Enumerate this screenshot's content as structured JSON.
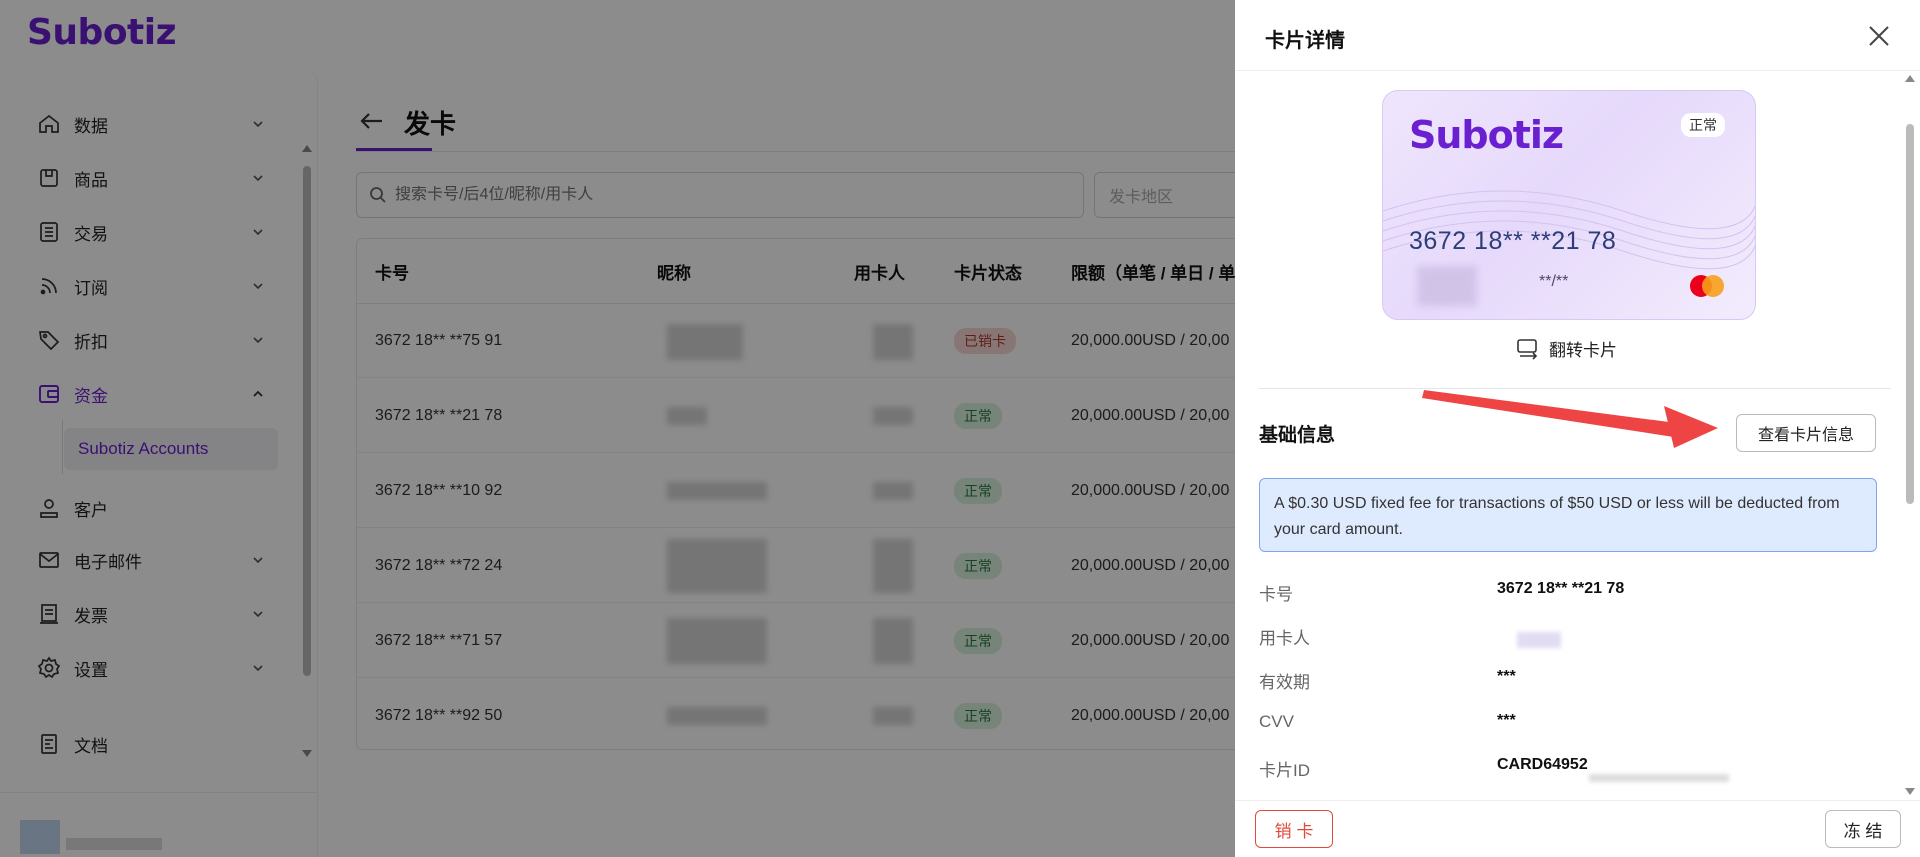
{
  "app": {
    "logo": "Subotiz"
  },
  "sidebar": {
    "items": [
      {
        "label": "数据",
        "icon": "home-icon",
        "expanded": false
      },
      {
        "label": "商品",
        "icon": "box-icon",
        "expanded": false
      },
      {
        "label": "交易",
        "icon": "list-icon",
        "expanded": false
      },
      {
        "label": "订阅",
        "icon": "rss-icon",
        "expanded": false
      },
      {
        "label": "折扣",
        "icon": "tag-icon",
        "expanded": false
      },
      {
        "label": "资金",
        "icon": "wallet-icon",
        "expanded": true
      },
      {
        "label": "客户",
        "icon": "user-icon",
        "expanded": false
      },
      {
        "label": "电子邮件",
        "icon": "mail-icon",
        "expanded": false
      },
      {
        "label": "发票",
        "icon": "invoice-icon",
        "expanded": false
      },
      {
        "label": "设置",
        "icon": "gear-icon",
        "expanded": false
      }
    ],
    "sub_item": "Subotiz Accounts",
    "docs": "文档",
    "active_color": "#6a1fd0"
  },
  "page": {
    "title": "发卡",
    "search_placeholder": "搜索卡号/后4位/昵称/用卡人",
    "region_placeholder": "发卡地区"
  },
  "table": {
    "headers": [
      "卡号",
      "昵称",
      "用卡人",
      "卡片状态",
      "限额（单笔 / 单日 / 单"
    ],
    "rows": [
      {
        "card": "3672 18** **75 91",
        "status": "已销卡",
        "status_type": "closed",
        "limit": "20,000.00USD / 20,00"
      },
      {
        "card": "3672 18** **21 78",
        "status": "正常",
        "status_type": "ok",
        "limit": "20,000.00USD / 20,00"
      },
      {
        "card": "3672 18** **10 92",
        "status": "正常",
        "status_type": "ok",
        "limit": "20,000.00USD / 20,00"
      },
      {
        "card": "3672 18** **72 24",
        "status": "正常",
        "status_type": "ok",
        "limit": "20,000.00USD / 20,00"
      },
      {
        "card": "3672 18** **71 57",
        "status": "正常",
        "status_type": "ok",
        "limit": "20,000.00USD / 20,00"
      },
      {
        "card": "3672 18** **92 50",
        "status": "正常",
        "status_type": "ok",
        "limit": "20,000.00USD / 20,00"
      }
    ]
  },
  "drawer": {
    "title": "卡片详情",
    "card": {
      "logo": "Subotiz",
      "status": "正常",
      "number": "3672 18** **21 78",
      "expiry": "**/**"
    },
    "flip_label": "翻转卡片",
    "section_title": "基础信息",
    "view_button": "查看卡片信息",
    "notice": "A $0.30 USD fixed fee for transactions of $50 USD or less will be deducted from your card amount.",
    "fields": [
      {
        "label": "卡号",
        "value": "3672 18** **21 78"
      },
      {
        "label": "用卡人",
        "value": ""
      },
      {
        "label": "有效期",
        "value": "***"
      },
      {
        "label": "CVV",
        "value": "***"
      },
      {
        "label": "卡片ID",
        "value": "CARD64952"
      }
    ],
    "cancel_button": "销 卡",
    "freeze_button": "冻 结"
  },
  "colors": {
    "brand": "#6a1fd0",
    "danger": "#e04a3a",
    "annotation_arrow": "#ee4444"
  }
}
